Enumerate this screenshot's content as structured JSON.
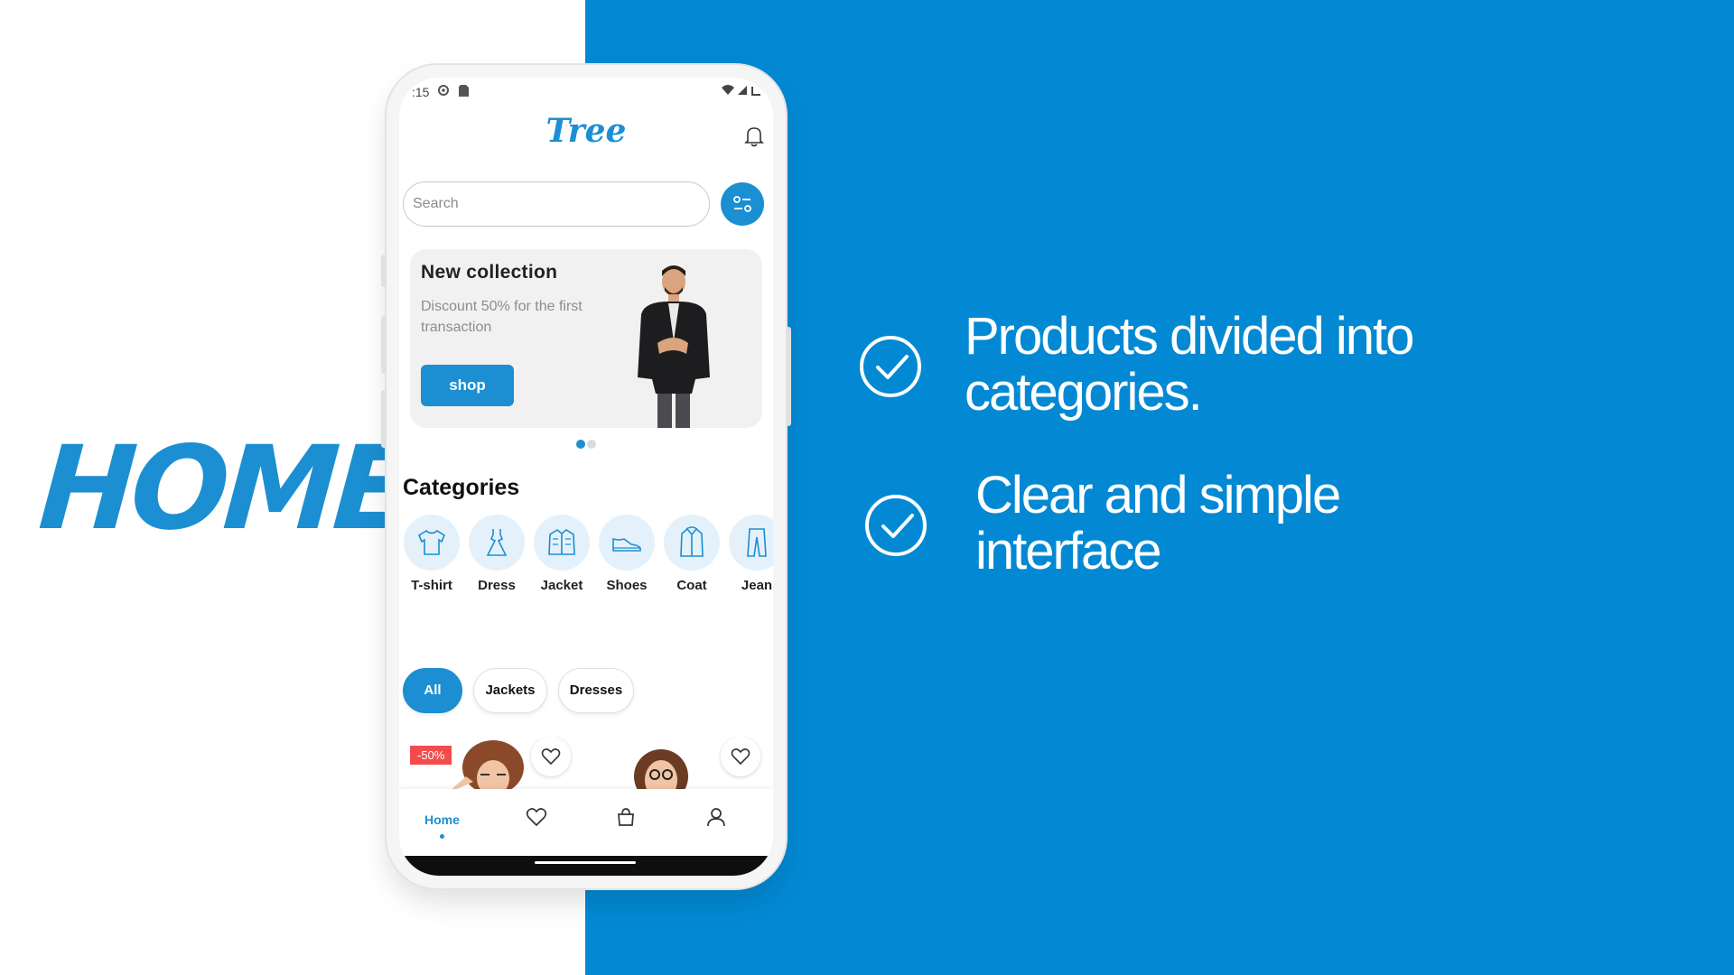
{
  "slide": {
    "title": "HOME",
    "features": [
      {
        "text_line1": "Products divided into",
        "text_line2": "categories."
      },
      {
        "text_line1": "Clear and simple",
        "text_line2": "interface"
      }
    ]
  },
  "colors": {
    "brand_blue": "#0389d3",
    "app_blue": "#1b8fd2",
    "discount_red": "#f24c4c"
  },
  "status_bar": {
    "time": ":15"
  },
  "app": {
    "title": "Tree",
    "search": {
      "placeholder": "Search",
      "value": ""
    },
    "banner": {
      "title": "New collection",
      "subtitle": "Discount 50% for the first transaction",
      "button": "shop"
    },
    "categories_title": "Categories",
    "categories": [
      {
        "label": "T-shirt",
        "icon": "tshirt-icon"
      },
      {
        "label": "Dress",
        "icon": "dress-icon"
      },
      {
        "label": "Jacket",
        "icon": "jacket-icon"
      },
      {
        "label": "Shoes",
        "icon": "shoes-icon"
      },
      {
        "label": "Coat",
        "icon": "coat-icon"
      },
      {
        "label": "Jean",
        "icon": "jeans-icon"
      }
    ],
    "filters": [
      {
        "label": "All",
        "active": true
      },
      {
        "label": "Jackets",
        "active": false
      },
      {
        "label": "Dresses",
        "active": false
      }
    ],
    "products": [
      {
        "discount": "-50%"
      },
      {
        "discount": ""
      }
    ],
    "nav": {
      "home_label": "Home"
    }
  }
}
